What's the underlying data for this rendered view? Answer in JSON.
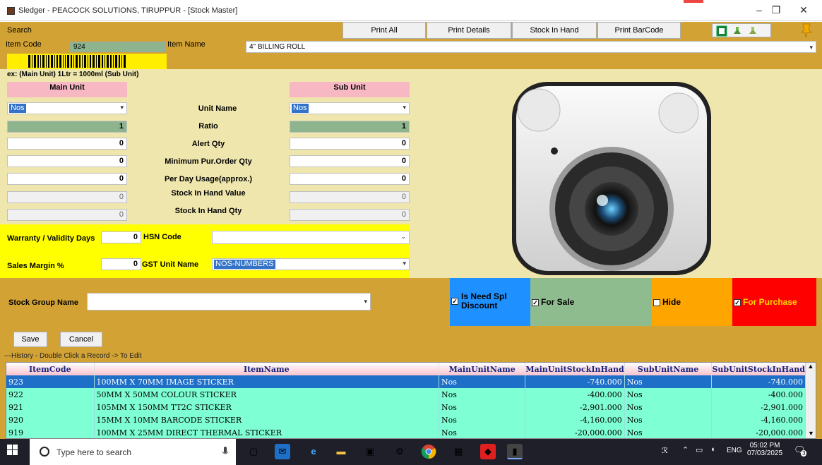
{
  "window": {
    "title": "Sledger - PEACOCK SOLUTIONS, TIRUPPUR - [Stock Master]",
    "minimize": "–",
    "restore": "❐",
    "close": "✕"
  },
  "toolbar": {
    "search_label": "Search",
    "print_all": "Print All",
    "print_details": "Print Details",
    "stock_in_hand": "Stock In Hand",
    "print_barcode": "Print BarCode"
  },
  "item": {
    "code_label": "Item Code",
    "code_value": "924",
    "name_label": "Item Name",
    "name_value": "4\" BILLING ROLL"
  },
  "hint": "ex: (Main Unit)  1Ltr = 1000ml (Sub Unit)",
  "units": {
    "main_header": "Main Unit",
    "sub_header": "Sub Unit",
    "main_unit_value": "Nos",
    "sub_unit_value": "Nos",
    "labels": {
      "unit_name": "Unit Name",
      "ratio": "Ratio",
      "alert_qty": "Alert Qty",
      "min_order": "Minimum Pur.Order Qty",
      "per_day": "Per Day Usage(approx.)",
      "sih_value": "Stock In Hand Value",
      "sih_qty": "Stock In Hand Qty"
    },
    "main": {
      "ratio": "1",
      "alert_qty": "0",
      "min_order": "0",
      "per_day": "0",
      "sih_value": "0",
      "sih_qty": "0"
    },
    "sub": {
      "ratio": "1",
      "alert_qty": "0",
      "min_order": "0",
      "per_day": "0",
      "sih_value": "0",
      "sih_qty": "0"
    }
  },
  "extra": {
    "warranty_label": "Warranty / Validity Days",
    "warranty_value": "0",
    "hsn_label": "HSN Code",
    "hsn_value": "",
    "margin_label": "Sales Margin %",
    "margin_value": "0",
    "gst_unit_label": "GST Unit Name",
    "gst_unit_value": "NOS-NUMBERS"
  },
  "stock_group": {
    "label": "Stock Group Name",
    "value": ""
  },
  "flags": {
    "spl_discount": "Is Need Spl Discount",
    "for_sale": "For Sale",
    "hide": "Hide",
    "for_purchase": "For Purchase",
    "spl_discount_checked": true,
    "for_sale_checked": true,
    "hide_checked": false,
    "for_purchase_checked": true,
    "colors": {
      "spl": "#1e90ff",
      "sale": "#8fbc8f",
      "hide": "#ffa500",
      "purchase": "#ff0000"
    }
  },
  "buttons": {
    "save": "Save",
    "cancel": "Cancel"
  },
  "history": {
    "label": "---History - Double Click a Record -> To Edit",
    "columns": [
      "ItemCode",
      "ItemName",
      "MainUnitName",
      "MainUnitStockInHand",
      "SubUnitName",
      "SubUnitStockInHand"
    ],
    "rows": [
      [
        "923",
        "100MM X 70MM IMAGE STICKER",
        "Nos",
        "-740.000",
        "Nos",
        "-740.000"
      ],
      [
        "922",
        "50MM X 50MM COLOUR STICKER",
        "Nos",
        "-400.000",
        "Nos",
        "-400.000"
      ],
      [
        "921",
        "105MM X 150MM TT2C STICKER",
        "Nos",
        "-2,901.000",
        "Nos",
        "-2,901.000"
      ],
      [
        "920",
        "15MM X 10MM BARCODE STICKER",
        "Nos",
        "-4,160.000",
        "Nos",
        "-4,160.000"
      ],
      [
        "919",
        "100MM X 25MM DIRECT THERMAL STICKER",
        "Nos",
        "-20,000.000",
        "Nos",
        "-20,000.000"
      ]
    ]
  },
  "taskbar": {
    "search_placeholder": "Type here to search",
    "lang": "ENG",
    "time": "05:02 PM",
    "date": "07/03/2025",
    "notif_count": "3"
  }
}
